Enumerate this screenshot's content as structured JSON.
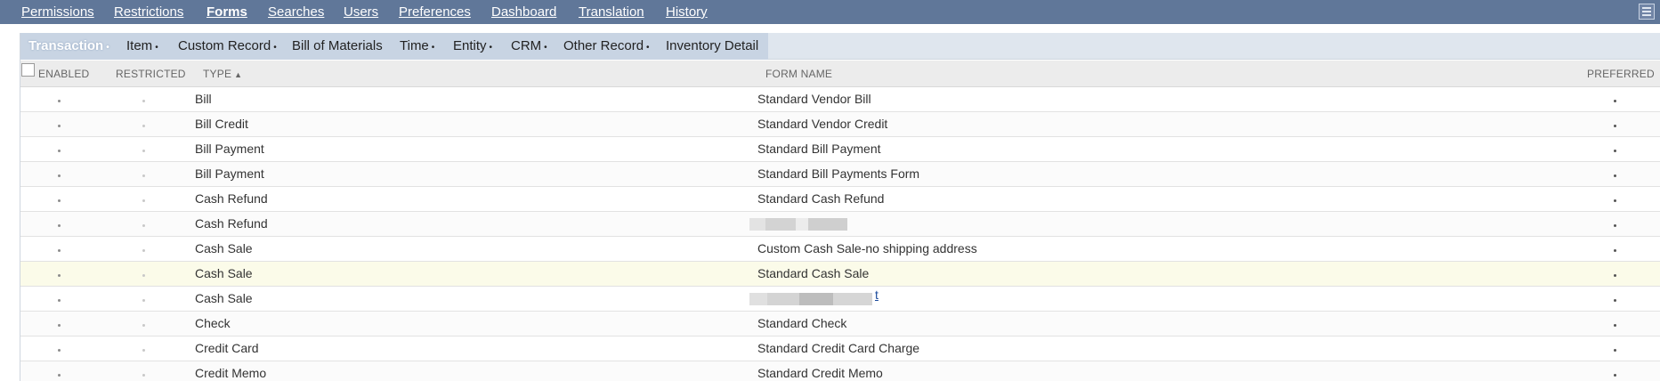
{
  "top_nav": {
    "tabs": [
      {
        "label": "Permissions"
      },
      {
        "label": "Restrictions"
      },
      {
        "label": "Forms",
        "active": true
      },
      {
        "label": "Searches"
      },
      {
        "label": "Users"
      },
      {
        "label": "Preferences"
      },
      {
        "label": "Dashboard"
      },
      {
        "label": "Translation"
      },
      {
        "label": "History"
      }
    ],
    "menu_icon": "hamburger-menu-icon",
    "bar_color": "#607799"
  },
  "sub_tabs": {
    "tabs": [
      {
        "label": "Transaction",
        "dot": "•",
        "active": true
      },
      {
        "label": "Item",
        "dot": "•"
      },
      {
        "label": "Custom Record",
        "dot": "•"
      },
      {
        "label": "Bill of Materials",
        "dot": ""
      },
      {
        "label": "Time",
        "dot": "•"
      },
      {
        "label": "Entity",
        "dot": "•"
      },
      {
        "label": "CRM",
        "dot": "•"
      },
      {
        "label": "Other Record",
        "dot": "•"
      },
      {
        "label": "Inventory Detail",
        "dot": ""
      }
    ]
  },
  "table": {
    "columns": {
      "enabled": "ENABLED",
      "restricted": "RESTRICTED",
      "type": "TYPE",
      "type_sort_indicator": "▲",
      "form_name": "FORM NAME",
      "preferred": "PREFERRED"
    },
    "rows": [
      {
        "type": "Bill",
        "form_name": "Standard Vendor Bill"
      },
      {
        "type": "Bill Credit",
        "form_name": "Standard Vendor Credit"
      },
      {
        "type": "Bill Payment",
        "form_name": "Standard Bill Payment"
      },
      {
        "type": "Bill Payment",
        "form_name": "Standard Bill Payments Form"
      },
      {
        "type": "Cash Refund",
        "form_name": "Standard Cash Refund"
      },
      {
        "type": "Cash Refund",
        "form_name": ""
      },
      {
        "type": "Cash Sale",
        "form_name": "Custom Cash Sale-no shipping address"
      },
      {
        "type": "Cash Sale",
        "form_name": "Standard Cash Sale",
        "highlighted": true
      },
      {
        "type": "Cash Sale",
        "form_name": "",
        "visible_suffix": "t"
      },
      {
        "type": "Check",
        "form_name": "Standard Check"
      },
      {
        "type": "Credit Card",
        "form_name": "Standard Credit Card Charge"
      },
      {
        "type": "Credit Memo",
        "form_name": "Standard Credit Memo"
      }
    ]
  }
}
